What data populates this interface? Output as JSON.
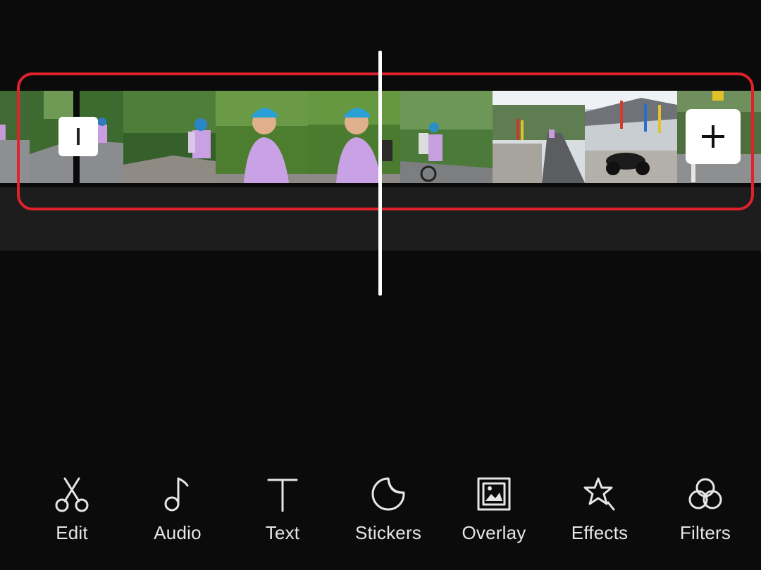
{
  "timeline": {
    "clips": [
      {
        "name": "clip-road-cyclists-1"
      },
      {
        "name": "clip-road-cyclists-2"
      },
      {
        "name": "clip-cyclist-green"
      },
      {
        "name": "clip-cyclist-closeup-1"
      },
      {
        "name": "clip-cyclist-closeup-2"
      },
      {
        "name": "clip-cyclists-riding"
      },
      {
        "name": "clip-village-road"
      },
      {
        "name": "clip-motorbike"
      },
      {
        "name": "clip-flags"
      }
    ],
    "highlight_color": "#e0222c"
  },
  "toolbar": {
    "items": [
      {
        "label": "Edit",
        "icon": "scissors-icon"
      },
      {
        "label": "Audio",
        "icon": "music-note-icon"
      },
      {
        "label": "Text",
        "icon": "text-icon"
      },
      {
        "label": "Stickers",
        "icon": "sticker-icon"
      },
      {
        "label": "Overlay",
        "icon": "overlay-icon"
      },
      {
        "label": "Effects",
        "icon": "star-effects-icon"
      },
      {
        "label": "Filters",
        "icon": "filters-icon"
      }
    ]
  }
}
